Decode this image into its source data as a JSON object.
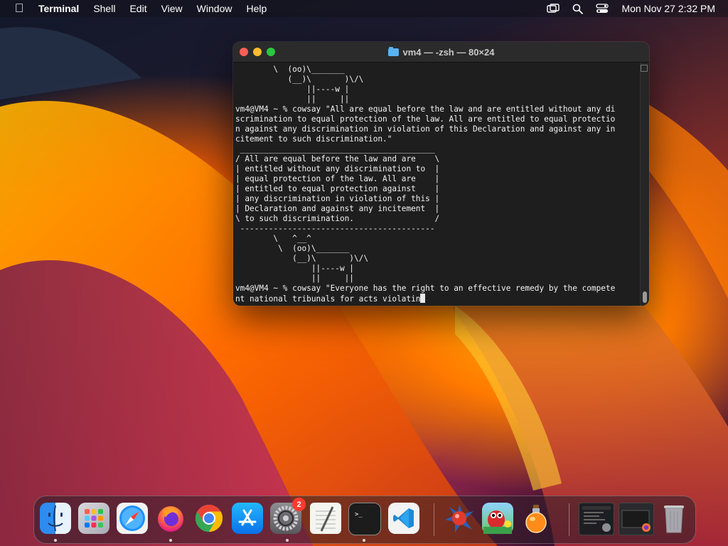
{
  "menubar": {
    "app_name": "Terminal",
    "items": [
      "Shell",
      "Edit",
      "View",
      "Window",
      "Help"
    ],
    "clock": "Mon Nov 27  2:32 PM"
  },
  "terminal": {
    "title": "vm4 — -zsh — 80×24",
    "lines": [
      "        \\  (oo)\\_______",
      "           (__)\\       )\\/\\",
      "               ||----w |",
      "               ||     ||",
      "vm4@VM4 ~ % cowsay \"All are equal before the law and are entitled without any di",
      "scrimination to equal protection of the law. All are entitled to equal protectio",
      "n against any discrimination in violation of this Declaration and against any in",
      "citement to such discrimination.\"",
      " _________________________________________",
      "/ All are equal before the law and are    \\",
      "| entitled without any discrimination to  |",
      "| equal protection of the law. All are    |",
      "| entitled to equal protection against    |",
      "| any discrimination in violation of this |",
      "| Declaration and against any incitement  |",
      "\\ to such discrimination.                 /",
      " -----------------------------------------",
      "        \\   ^__^",
      "         \\  (oo)\\_______",
      "            (__)\\       )\\/\\",
      "                ||----w |",
      "                ||     ||",
      "vm4@VM4 ~ % cowsay \"Everyone has the right to an effective remedy by the compete",
      "nt national tribunals for acts violatin"
    ]
  },
  "dock": {
    "items": [
      {
        "name": "Finder",
        "icon": "finder-icon",
        "running": true
      },
      {
        "name": "Launchpad",
        "icon": "launchpad-icon",
        "running": false
      },
      {
        "name": "Safari",
        "icon": "safari-icon",
        "running": false
      },
      {
        "name": "Firefox",
        "icon": "firefox-icon",
        "running": true
      },
      {
        "name": "Google Chrome",
        "icon": "chrome-icon",
        "running": false
      },
      {
        "name": "App Store",
        "icon": "app-store-icon",
        "running": false
      },
      {
        "name": "System Settings",
        "icon": "system-settings-icon",
        "running": true,
        "badge": "2"
      },
      {
        "name": "TextEdit",
        "icon": "textedit-icon",
        "running": false
      },
      {
        "name": "Terminal",
        "icon": "terminal-icon",
        "running": true
      },
      {
        "name": "Visual Studio Code",
        "icon": "vscode-icon",
        "running": false
      },
      {
        "name": "Ball game",
        "icon": "ball-game-icon",
        "running": false
      },
      {
        "name": "Frog game",
        "icon": "frog-game-icon",
        "running": false
      },
      {
        "name": "Potion app",
        "icon": "potion-icon",
        "running": false
      },
      {
        "name": "Window thumbnail 1",
        "icon": "window-thumbnail-icon",
        "running": false
      },
      {
        "name": "Window thumbnail 2",
        "icon": "window-thumbnail-icon",
        "running": false
      },
      {
        "name": "Trash",
        "icon": "trash-icon",
        "running": false
      }
    ]
  }
}
